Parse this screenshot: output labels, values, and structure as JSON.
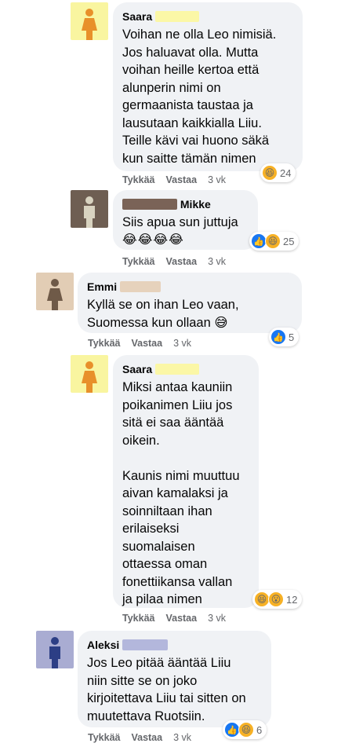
{
  "comments": [
    {
      "author": "Saara",
      "text": "Voihan ne olla Leo nimisiä.\nJos haluavat olla. Mutta\nvoihan heille kertoa että\nalunperin nimi on\ngermaanista taustaa ja\nlausutaan kaikkialla Liiu.\nTeille kävi vai huono säkä\nkun saitte tämän nimen",
      "reaction_count": "24",
      "reactions": [
        "haha"
      ],
      "like_label": "Tykkää",
      "reply_label": "Vastaa",
      "time": "3 vk",
      "avatar_color": "#f9f5a0",
      "avatar_figure": "#e8902a",
      "redact_color": "#fbf7a6"
    },
    {
      "author": "Mikke",
      "text": "Siis apua sun juttuja",
      "emojis": "😂😂😂😂",
      "reaction_count": "25",
      "reactions": [
        "like",
        "haha"
      ],
      "like_label": "Tykkää",
      "reply_label": "Vastaa",
      "time": "3 vk",
      "avatar_color": "#6e5e52",
      "avatar_figure": "#d8d3c0",
      "redact_color": "#7a6357"
    },
    {
      "author": "Emmi",
      "text": "Kyllä se on ihan Leo vaan,\nSuomessa kun ollaan",
      "emojis": "😅",
      "reaction_count": "5",
      "reactions": [
        "like"
      ],
      "like_label": "Tykkää",
      "reply_label": "Vastaa",
      "time": "3 vk",
      "avatar_color": "#e2cdb5",
      "avatar_figure": "#6f5a48",
      "redact_color": "#e6d2bc"
    },
    {
      "author": "Saara",
      "text": "Miksi antaa kauniin\npoikanimen Liiu jos\nsitä ei saa ääntää\noikein.\n\nKaunis nimi muuttuu\naivan kamalaksi ja\nsoinniltaan ihan\nerilaiseksi\nsuomalaisen\nottaessa oman\nfonettiikansa vallan\nja pilaa nimen",
      "reaction_count": "12",
      "reactions": [
        "haha",
        "wow"
      ],
      "like_label": "Tykkää",
      "reply_label": "Vastaa",
      "time": "3 vk",
      "avatar_color": "#f9f5a0",
      "avatar_figure": "#e8902a",
      "redact_color": "#fbf7a6"
    },
    {
      "author": "Aleksi",
      "text": "Jos Leo pitää ääntää Liiu\nniin sitte se on joko\nkirjoitettava Liiu tai sitten on\nmuutettava Ruotsiin.",
      "reaction_count": "6",
      "reactions": [
        "like",
        "haha"
      ],
      "like_label": "Tykkää",
      "reply_label": "Vastaa",
      "time": "3 vk",
      "avatar_color": "#a9acd2",
      "avatar_figure": "#2c3e85",
      "redact_color": "#b3b7dc"
    }
  ]
}
